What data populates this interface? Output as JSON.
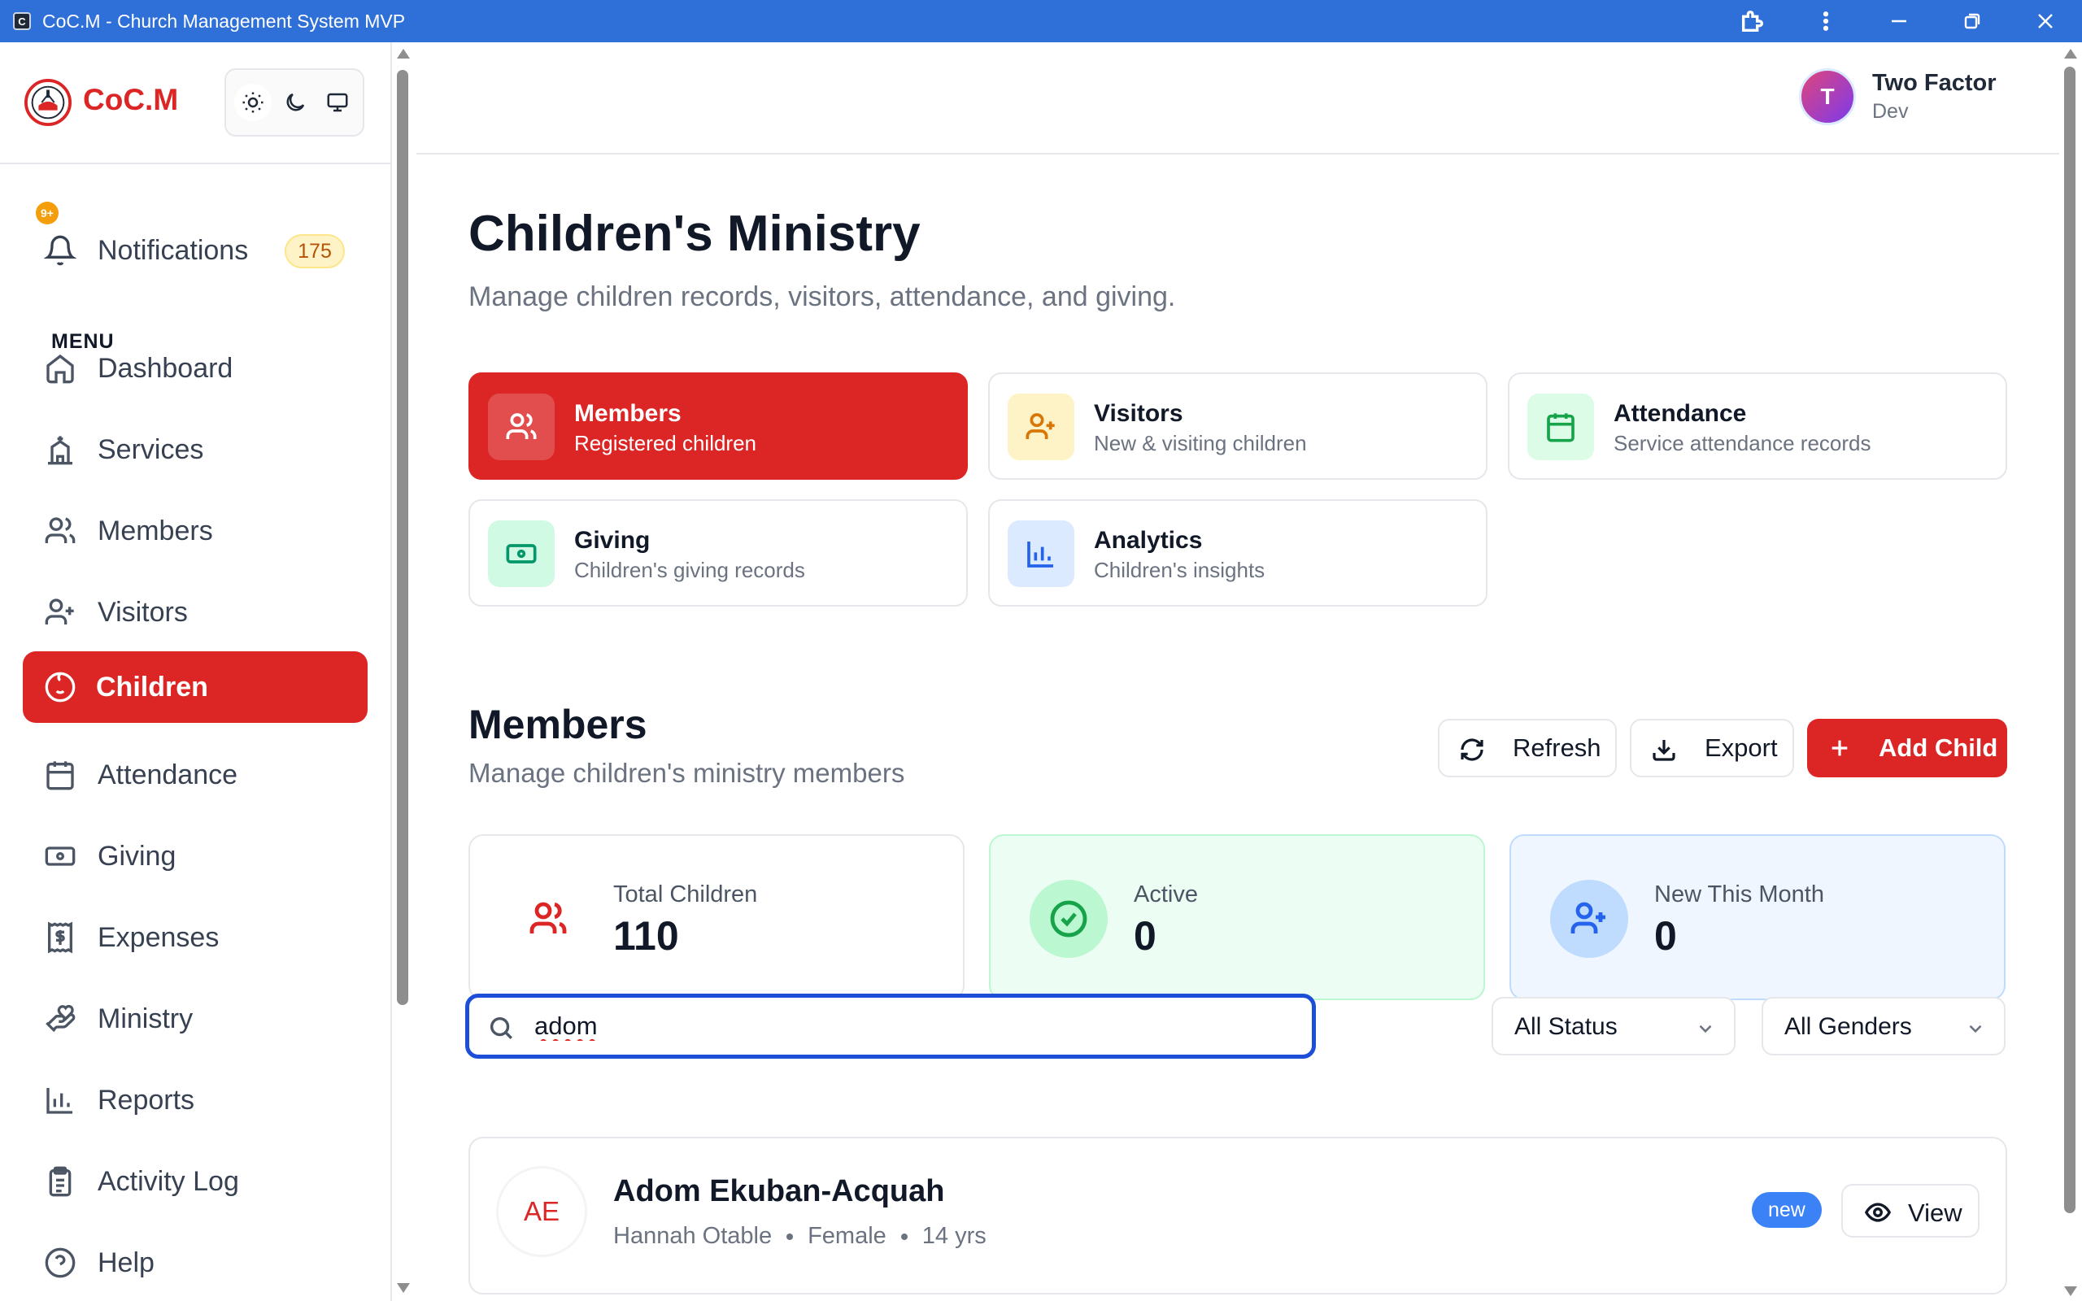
{
  "window": {
    "title": "CoC.M - Church Management System MVP",
    "app_icon_letter": "C"
  },
  "brand": {
    "name": "CoC.M",
    "accent": "#dc2626"
  },
  "theme_switch": {
    "options": [
      "light-mode-icon",
      "dark-mode-icon",
      "system-mode-icon"
    ],
    "selected": "light"
  },
  "notifications": {
    "label": "Notifications",
    "count": "175",
    "dot": "9+"
  },
  "sidebar": {
    "menu_heading": "MENU",
    "items": [
      {
        "label": "Dashboard",
        "icon": "home-icon"
      },
      {
        "label": "Services",
        "icon": "church-icon"
      },
      {
        "label": "Members",
        "icon": "users-icon"
      },
      {
        "label": "Visitors",
        "icon": "user-plus-icon"
      },
      {
        "label": "Children",
        "icon": "baby-icon",
        "active": true
      },
      {
        "label": "Attendance",
        "icon": "calendar-icon"
      },
      {
        "label": "Giving",
        "icon": "banknote-icon"
      },
      {
        "label": "Expenses",
        "icon": "receipt-icon"
      },
      {
        "label": "Ministry",
        "icon": "hand-heart-icon"
      },
      {
        "label": "Reports",
        "icon": "bar-chart-icon"
      },
      {
        "label": "Activity Log",
        "icon": "clipboard-icon"
      },
      {
        "label": "Help",
        "icon": "help-circle-icon"
      }
    ]
  },
  "user": {
    "initial": "T",
    "name": "Two Factor",
    "role": "Dev"
  },
  "page": {
    "title": "Children's Ministry",
    "subtitle": "Manage children records, visitors, attendance, and giving."
  },
  "tiles": [
    {
      "title": "Members",
      "subtitle": "Registered children",
      "icon": "users-icon",
      "active": true
    },
    {
      "title": "Visitors",
      "subtitle": "New & visiting children",
      "icon": "user-plus-icon",
      "color": "#d97706",
      "bg": "#fef3c7"
    },
    {
      "title": "Attendance",
      "subtitle": "Service attendance records",
      "icon": "calendar-icon",
      "color": "#16a34a",
      "bg": "#dcfce7"
    },
    {
      "title": "Giving",
      "subtitle": "Children's giving records",
      "icon": "banknote-icon",
      "color": "#059669",
      "bg": "#d1fae5"
    },
    {
      "title": "Analytics",
      "subtitle": "Children's insights",
      "icon": "bar-chart-icon",
      "color": "#2563eb",
      "bg": "#dbeafe"
    }
  ],
  "section": {
    "title": "Members",
    "subtitle": "Manage children's ministry members",
    "refresh_label": "Refresh",
    "export_label": "Export",
    "add_label": "Add Child"
  },
  "stats": [
    {
      "label": "Total Children",
      "value": "110",
      "icon": "users-icon"
    },
    {
      "label": "Active",
      "value": "0",
      "icon": "check-circle-icon"
    },
    {
      "label": "New This Month",
      "value": "0",
      "icon": "user-plus-icon"
    }
  ],
  "filters": {
    "search_value": "adom",
    "status_selected": "All Status",
    "gender_selected": "All Genders"
  },
  "results": [
    {
      "initials": "AE",
      "name": "Adom Ekuban-Acquah",
      "guardian": "Hannah Otable",
      "gender": "Female",
      "age": "14 yrs",
      "badge": "new",
      "action_label": "View"
    }
  ]
}
